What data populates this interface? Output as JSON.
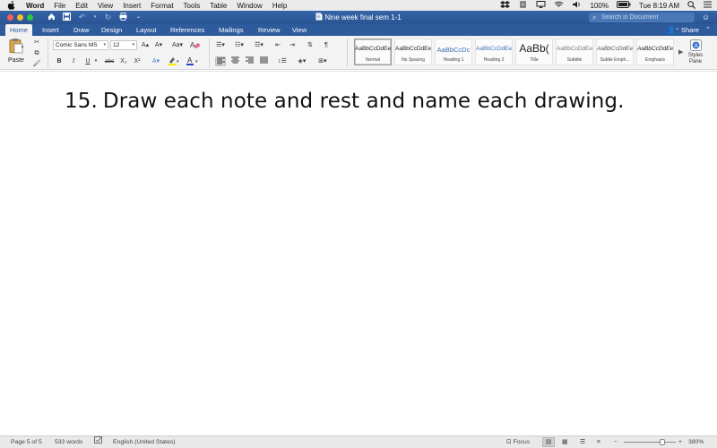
{
  "menubar": {
    "app_name": "Word",
    "items": [
      "File",
      "Edit",
      "View",
      "Insert",
      "Format",
      "Tools",
      "Table",
      "Window",
      "Help"
    ],
    "battery": "100%",
    "clock": "Tue 8:19 AM"
  },
  "titlebar": {
    "document_title": "Nine week final sem 1-1",
    "search_placeholder": "Search in Document"
  },
  "tabs": {
    "items": [
      "Home",
      "Insert",
      "Draw",
      "Design",
      "Layout",
      "References",
      "Mailings",
      "Review",
      "View"
    ],
    "active": "Home",
    "share_label": "Share"
  },
  "ribbon": {
    "paste_label": "Paste",
    "font_name": "Comic Sans MS",
    "font_size": "12",
    "bold": "B",
    "italic": "I",
    "underline": "U",
    "strike": "abc",
    "subscript": "X₂",
    "superscript": "X²",
    "styles": [
      {
        "sample": "AaBbCcDdEe",
        "name": "Normal"
      },
      {
        "sample": "AaBbCcDdEe",
        "name": "No Spacing"
      },
      {
        "sample": "AaBbCcDc",
        "name": "Heading 1"
      },
      {
        "sample": "AaBbCcDdEe",
        "name": "Heading 2"
      },
      {
        "sample": "AaBb(",
        "name": "Title"
      },
      {
        "sample": "AaBbCcDdEe",
        "name": "Subtitle"
      },
      {
        "sample": "AaBbCcDdEe",
        "name": "Subtle Emph..."
      },
      {
        "sample": "AaBbCcDdEe",
        "name": "Emphasis"
      }
    ],
    "styles_pane_line1": "Styles",
    "styles_pane_line2": "Pane"
  },
  "document": {
    "number": "15.",
    "text": "Draw each note and rest and name each drawing."
  },
  "status": {
    "page": "Page 5 of 5",
    "words": "533 words",
    "language": "English (United States)",
    "focus": "Focus",
    "zoom": "380%"
  }
}
